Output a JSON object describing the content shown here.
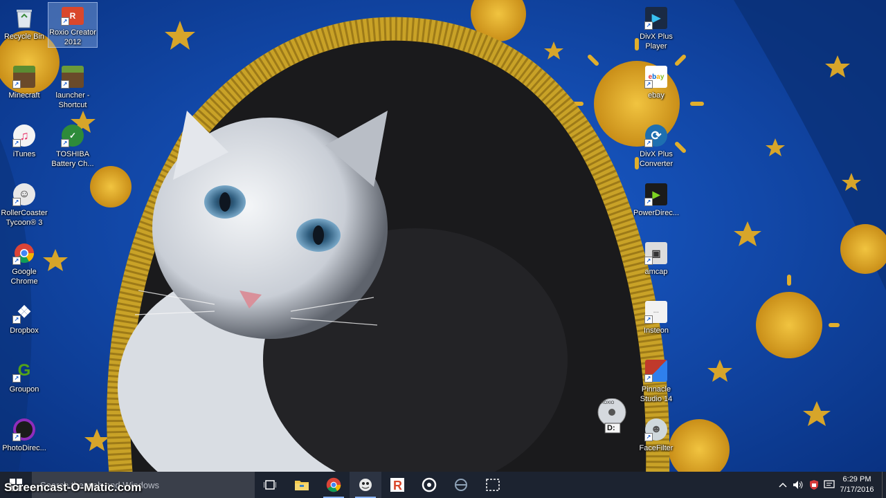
{
  "desktop": {
    "left_icons": [
      {
        "name": "recycle-bin",
        "label": "Recycle Bin",
        "icon": "recycle-bin-icon",
        "color": "#c8d6e5"
      },
      {
        "name": "roxio-creator-2012",
        "label": "Roxio Creator 2012",
        "icon": "roxio-icon",
        "color": "#d9472b",
        "selected": true
      },
      {
        "name": "minecraft",
        "label": "Minecraft",
        "icon": "minecraft-icon",
        "color": "#5b8c32"
      },
      {
        "name": "launcher-shortcut",
        "label": "launcher - Shortcut",
        "icon": "minecraft-launcher-icon",
        "color": "#6b9a3a"
      },
      {
        "name": "itunes",
        "label": "iTunes",
        "icon": "itunes-icon",
        "color": "#f4f4f4"
      },
      {
        "name": "toshiba-battery",
        "label": "TOSHIBA Battery Ch...",
        "icon": "battery-check-icon",
        "color": "#2e8b3a"
      },
      {
        "name": "rollercoaster-tycoon-3",
        "label": "RollerCoaster Tycoon® 3",
        "icon": "rct3-icon",
        "color": "#e8e8e8"
      },
      {
        "name": "google-chrome",
        "label": "Google Chrome",
        "icon": "chrome-icon",
        "color": "#db4437"
      },
      {
        "name": "dropbox",
        "label": "Dropbox",
        "icon": "dropbox-icon",
        "color": "#0061fe"
      },
      {
        "name": "groupon",
        "label": "Groupon",
        "icon": "groupon-icon",
        "color": "#53a318"
      },
      {
        "name": "photodirector",
        "label": "PhotoDirec...",
        "icon": "photodirector-icon",
        "color": "#1b1b1b"
      }
    ],
    "right_icons": [
      {
        "name": "divx-plus-player",
        "label": "DivX Plus Player",
        "icon": "divx-player-icon",
        "color": "#1a2a44"
      },
      {
        "name": "ebay",
        "label": "ebay",
        "icon": "ebay-icon",
        "color": "#ffffff"
      },
      {
        "name": "divx-plus-converter",
        "label": "DivX Plus Converter",
        "icon": "divx-converter-icon",
        "color": "#1e6fb0"
      },
      {
        "name": "powerdirector",
        "label": "PowerDirec...",
        "icon": "powerdirector-icon",
        "color": "#1b1b1b"
      },
      {
        "name": "amcap",
        "label": "amcap",
        "icon": "amcap-icon",
        "color": "#dcdcdc"
      },
      {
        "name": "insteon",
        "label": "Insteon",
        "icon": "insteon-icon",
        "color": "#f2f2f2"
      },
      {
        "name": "pinnacle-studio-14",
        "label": "Pinnacle Studio 14",
        "icon": "pinnacle-icon",
        "color": "#c0392b"
      },
      {
        "name": "facefilter",
        "label": "FaceFilter",
        "icon": "facefilter-icon",
        "color": "#cfd8dc"
      }
    ],
    "drive_label": "D:",
    "drive_brand": "ROXIO"
  },
  "taskbar": {
    "search_placeholder": "Search the web and Windows",
    "apps": [
      {
        "name": "task-view",
        "icon": "task-view-icon"
      },
      {
        "name": "file-explorer",
        "icon": "folder-icon"
      },
      {
        "name": "chrome",
        "icon": "chrome-icon"
      },
      {
        "name": "rct3",
        "icon": "rct3-icon"
      },
      {
        "name": "roxio",
        "icon": "roxio-icon"
      },
      {
        "name": "groove",
        "icon": "disc-icon"
      },
      {
        "name": "network-app",
        "icon": "network-icon"
      },
      {
        "name": "screen-capture",
        "icon": "selection-icon"
      }
    ],
    "tray": {
      "time": "6:29 PM",
      "date": "7/17/2016"
    }
  },
  "watermark": "Screencast-O-Matic.com",
  "colors": {
    "taskbar": "#1c2330",
    "wallpaper_blue": "#0b3a8f",
    "fringe_gold": "#c9a227",
    "cat_dark": "#1a1a1c"
  }
}
